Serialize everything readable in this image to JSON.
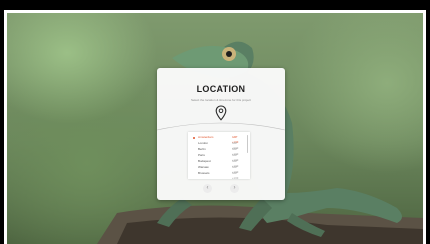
{
  "modal": {
    "title": "LOCATION",
    "subtitle": "Select the location & timezone for this project",
    "icon": "location-pin-icon"
  },
  "locations": [
    {
      "name": "Amsterdam",
      "time": "GMT +1:00",
      "selected": true
    },
    {
      "name": "London",
      "time": "GMT +0:00",
      "selected": false
    },
    {
      "name": "Berlin",
      "time": "GMT +1:00",
      "selected": false
    },
    {
      "name": "Paris",
      "time": "GMT +1:00",
      "selected": false
    },
    {
      "name": "Budapest",
      "time": "GMT +1:00",
      "selected": false
    },
    {
      "name": "Warsaw",
      "time": "GMT +1:00",
      "selected": false
    },
    {
      "name": "Brussels",
      "time": "GMT +1:00",
      "selected": false
    }
  ],
  "navigation": {
    "prev_icon": "‹",
    "next_icon": "›"
  },
  "colors": {
    "accent": "#e0562e",
    "modal_bg": "#fafafa"
  }
}
